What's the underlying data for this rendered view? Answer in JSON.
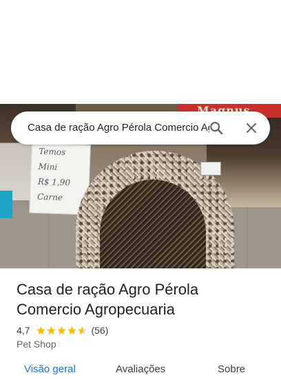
{
  "search": {
    "query": "Casa de ração Agro Pérola Comercio Agropecuaria"
  },
  "photo": {
    "store_sign": "Magnus",
    "poster_lines": [
      "Temos",
      "Mini",
      "R$ 1,90",
      "Carne"
    ]
  },
  "place": {
    "name": "Casa de ração Agro Pérola Comercio Agropecuaria",
    "rating": "4,7",
    "rating_value": 4.7,
    "review_count": "(56)",
    "category": "Pet Shop",
    "star_color": "#fbbc04"
  },
  "tabs": [
    {
      "label": "Visão geral",
      "active": true
    },
    {
      "label": "Avaliações",
      "active": false
    },
    {
      "label": "Sobre",
      "active": false
    }
  ],
  "colors": {
    "accent": "#1a73e8",
    "text_primary": "#202124",
    "text_secondary": "#5f6368"
  }
}
